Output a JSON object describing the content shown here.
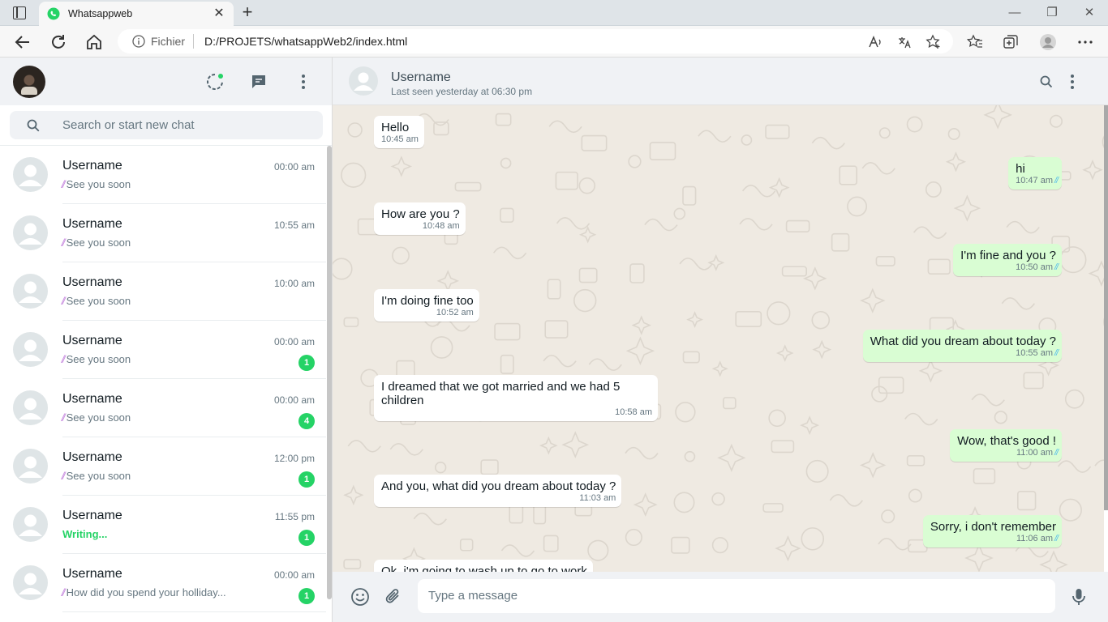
{
  "browser": {
    "tab_title": "Whatsappweb",
    "url_prefix": "Fichier",
    "url": "D:/PROJETS/whatsappWeb2/index.html"
  },
  "sidebar": {
    "search_placeholder": "Search or start new chat",
    "chats": [
      {
        "name": "Username",
        "time": "00:00 am",
        "preview": "See you soon",
        "badge": "",
        "writing": false
      },
      {
        "name": "Username",
        "time": "10:55 am",
        "preview": "See you soon",
        "badge": "",
        "writing": false
      },
      {
        "name": "Username",
        "time": "10:00 am",
        "preview": "See you soon",
        "badge": "",
        "writing": false
      },
      {
        "name": "Username",
        "time": "00:00 am",
        "preview": "See you soon",
        "badge": "1",
        "writing": false
      },
      {
        "name": "Username",
        "time": "00:00 am",
        "preview": "See you soon",
        "badge": "4",
        "writing": false
      },
      {
        "name": "Username",
        "time": "12:00 pm",
        "preview": "See you soon",
        "badge": "1",
        "writing": false
      },
      {
        "name": "Username",
        "time": "11:55 pm",
        "preview": "Writing...",
        "badge": "1",
        "writing": true
      },
      {
        "name": "Username",
        "time": "00:00 am",
        "preview": "How did you spend your holliday...",
        "badge": "1",
        "writing": false
      }
    ]
  },
  "conversation": {
    "contact_name": "Username",
    "last_seen": "Last seen yesterday at 06:30 pm",
    "messages": [
      {
        "dir": "in",
        "text": "Hello",
        "time": "10:45 am"
      },
      {
        "dir": "out",
        "text": "hi",
        "time": "10:47 am"
      },
      {
        "dir": "in",
        "text": "How are you ?",
        "time": "10:48 am"
      },
      {
        "dir": "out",
        "text": "I'm fine and you ?",
        "time": "10:50 am"
      },
      {
        "dir": "in",
        "text": "I'm doing fine too",
        "time": "10:52 am"
      },
      {
        "dir": "out",
        "text": "What did you dream about today ?",
        "time": "10:55 am"
      },
      {
        "dir": "in",
        "text": "I dreamed that we got married and we had 5 children",
        "time": "10:58 am"
      },
      {
        "dir": "out",
        "text": "Wow, that's good !",
        "time": "11:00 am"
      },
      {
        "dir": "in",
        "text": "And you, what did you dream about today ?",
        "time": "11:03 am"
      },
      {
        "dir": "out",
        "text": "Sorry, i don't remember",
        "time": "11:06 am"
      },
      {
        "dir": "in",
        "text": "Ok, i'm going to wash up to go to work",
        "time": ""
      }
    ],
    "input_placeholder": "Type a message"
  },
  "colors": {
    "accent": "#25d366",
    "outgoing_bubble": "#d9fdd3",
    "read_ticks": "#53bdeb",
    "chat_background": "#efeae2"
  }
}
